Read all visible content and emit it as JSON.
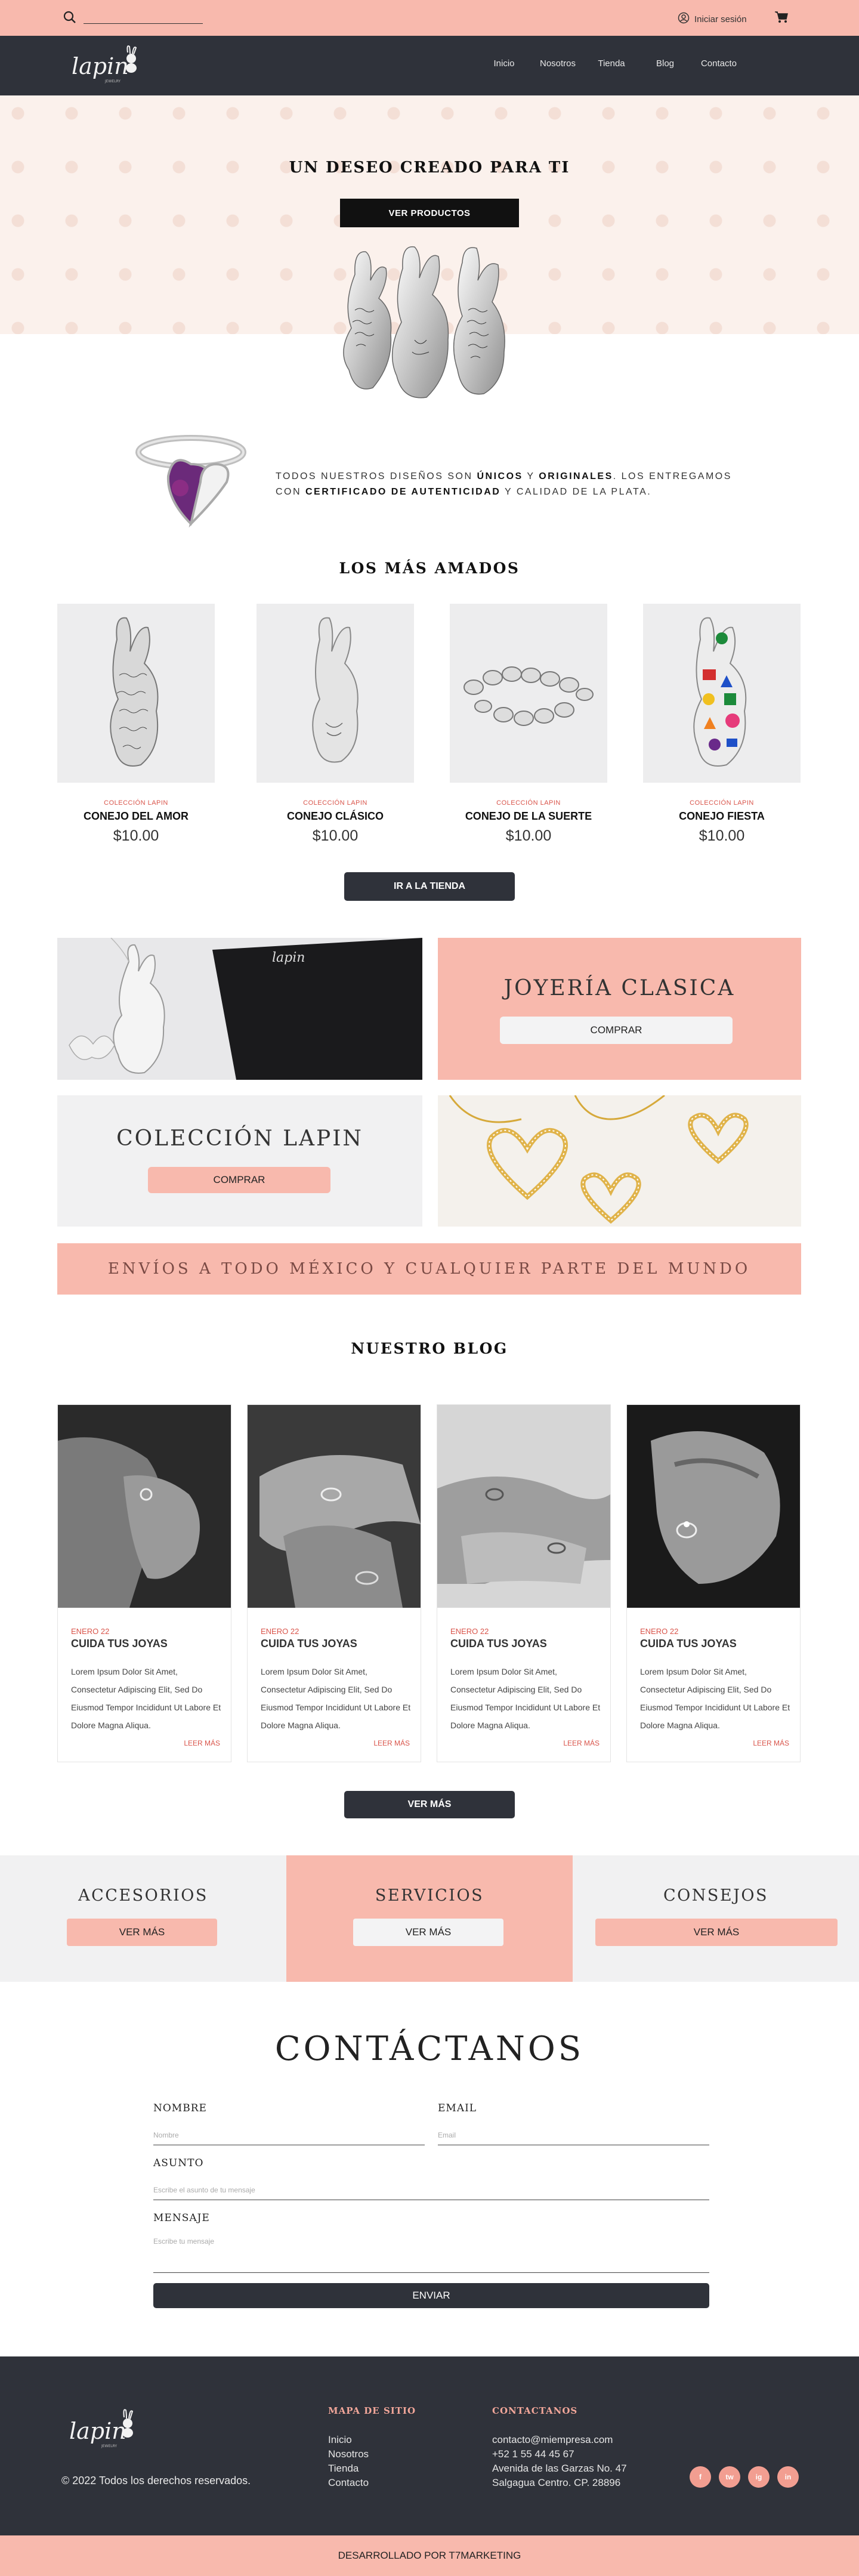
{
  "topbar": {
    "login_label": "Iniciar sesión"
  },
  "nav": {
    "items": [
      "Inicio",
      "Nosotros",
      "Tienda",
      "Blog",
      "Contacto"
    ]
  },
  "hero": {
    "title": "UN DESEO CREADO PARA TI",
    "button": "VER PRODUCTOS"
  },
  "about": {
    "part1": "TODOS NUESTROS DISEÑOS SON ",
    "bold1": "ÚNICOS",
    "part2": " Y ",
    "bold2": "ORIGINALES",
    "part3": ". LOS ENTREGAMOS CON ",
    "bold3": "CERTIFICADO DE AUTENTICIDAD",
    "part4": " Y CALIDAD DE LA PLATA."
  },
  "featured": {
    "title": "LOS MÁS AMADOS",
    "products": [
      {
        "collection": "COLECCIÓN LAPIN",
        "name": "CONEJO DEL AMOR",
        "price": "$10.00"
      },
      {
        "collection": "COLECCIÓN LAPIN",
        "name": "CONEJO CLÁSICO",
        "price": "$10.00"
      },
      {
        "collection": "COLECCIÓN LAPIN",
        "name": "CONEJO DE LA SUERTE",
        "price": "$10.00"
      },
      {
        "collection": "COLECCIÓN LAPIN",
        "name": "CONEJO FIESTA",
        "price": "$10.00"
      }
    ],
    "button": "IR A LA TIENDA"
  },
  "promos": {
    "classic": {
      "title": "JOYERÍA CLASICA",
      "button": "COMPRAR"
    },
    "lapin": {
      "title": "COLECCIÓN LAPIN",
      "button": "COMPRAR"
    }
  },
  "shipping_banner": "ENVÍOS A TODO MÉXICO Y CUALQUIER PARTE DEL MUNDO",
  "blog": {
    "title": "NUESTRO BLOG",
    "posts": [
      {
        "date": "ENERO 22",
        "title": "CUIDA TUS JOYAS",
        "body": "Lorem Ipsum Dolor Sit Amet, Consectetur Adipiscing Elit, Sed Do Eiusmod Tempor Incididunt Ut Labore Et Dolore Magna Aliqua.",
        "more": "LEER MÁS"
      },
      {
        "date": "ENERO 22",
        "title": "CUIDA TUS JOYAS",
        "body": "Lorem Ipsum Dolor Sit Amet, Consectetur Adipiscing Elit, Sed Do Eiusmod Tempor Incididunt Ut Labore Et Dolore Magna Aliqua.",
        "more": "LEER MÁS"
      },
      {
        "date": "ENERO 22",
        "title": "CUIDA TUS JOYAS",
        "body": "Lorem Ipsum Dolor Sit Amet, Consectetur Adipiscing Elit, Sed Do Eiusmod Tempor Incididunt Ut Labore Et Dolore Magna Aliqua.",
        "more": "LEER MÁS"
      },
      {
        "date": "ENERO 22",
        "title": "CUIDA TUS JOYAS",
        "body": "Lorem Ipsum Dolor Sit Amet, Consectetur Adipiscing Elit, Sed Do Eiusmod Tempor Incididunt Ut Labore Et Dolore Magna Aliqua.",
        "more": "LEER MÁS"
      }
    ],
    "button": "VER MÁS"
  },
  "categories": [
    {
      "title": "ACCESORIOS",
      "button": "VER MÁS"
    },
    {
      "title": "SERVICIOS",
      "button": "VER MÁS"
    },
    {
      "title": "CONSEJOS",
      "button": "VER MÁS"
    }
  ],
  "contact": {
    "title": "CONTÁCTANOS",
    "name_label": "NOMBRE",
    "name_placeholder": "Nombre",
    "email_label": "EMAIL",
    "email_placeholder": "Email",
    "subject_label": "ASUNTO",
    "subject_placeholder": "Escribe el asunto de tu mensaje",
    "message_label": "MENSAJE",
    "message_placeholder": "Escribe tu mensaje",
    "send": "ENVIAR"
  },
  "footer": {
    "copyright": "© 2022 Todos los derechos reservados.",
    "sitemap_title": "MAPA DE SITIO",
    "sitemap": [
      "Inicio",
      "Nosotros",
      "Tienda",
      "Contacto"
    ],
    "contact_title": "CONTACTANOS",
    "contact_lines": [
      "contacto@miempresa.com",
      "+52 1 55 44 45 67",
      "Avenida de las Garzas No. 47",
      "Salgagua Centro. CP. 28896"
    ],
    "social": [
      "f",
      "tw",
      "ig",
      "in"
    ],
    "credit": "DESARROLLADO POR T7MARKETING"
  },
  "colors": {
    "pink": "#f8b9ad",
    "dark": "#2f323a",
    "accent_red": "#d9544a",
    "light_gray": "#f1f1f2"
  }
}
